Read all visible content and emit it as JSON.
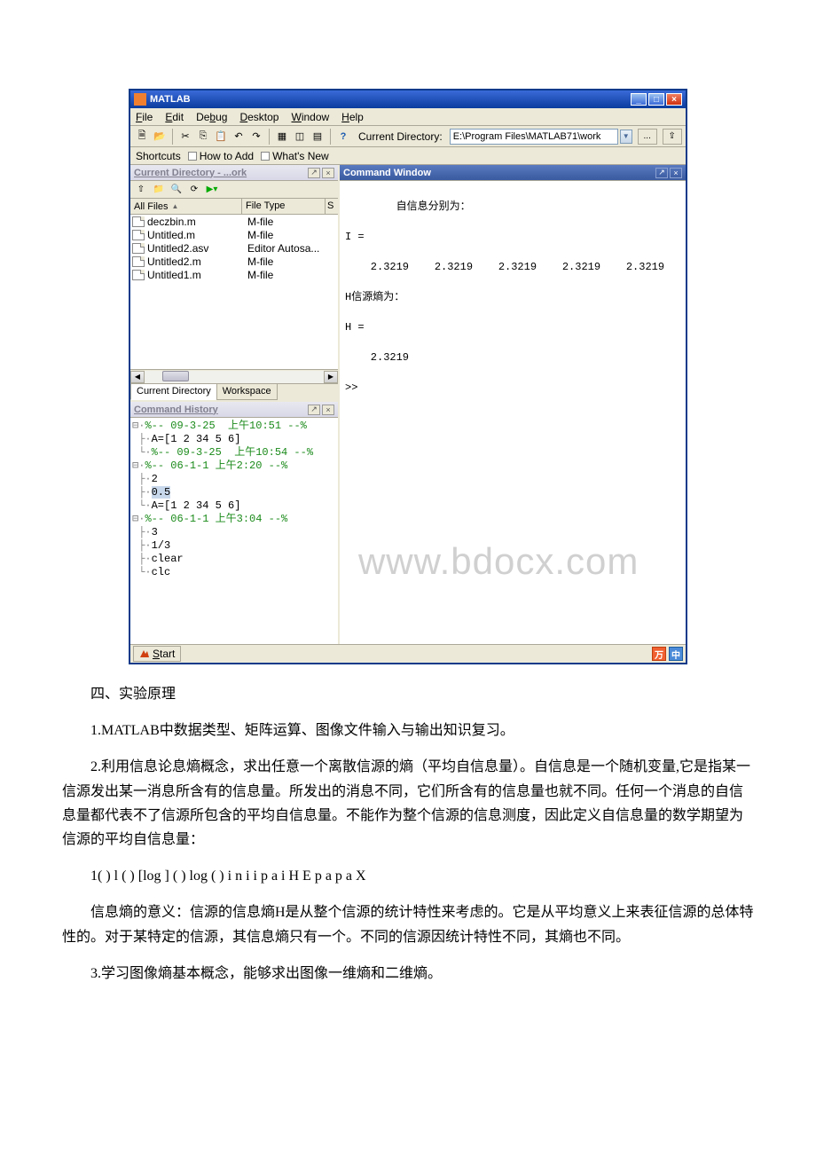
{
  "window": {
    "title": "MATLAB",
    "menus": [
      "File",
      "Edit",
      "Debug",
      "Desktop",
      "Window",
      "Help"
    ],
    "menu_accel": [
      "F",
      "E",
      "b",
      "D",
      "W",
      "H"
    ],
    "curdir_label": "Current Directory:",
    "curdir_value": "E:\\Program Files\\MATLAB71\\work",
    "shortcuts_label": "Shortcuts",
    "shortcuts": [
      "How to Add",
      "What's New"
    ]
  },
  "curdir_panel": {
    "title": "Current Directory - ...ork",
    "columns": [
      "All Files",
      "File Type",
      "S"
    ],
    "files": [
      {
        "name": "deczbin.m",
        "type": "M-file"
      },
      {
        "name": "Untitled.m",
        "type": "M-file"
      },
      {
        "name": "Untitled2.asv",
        "type": "Editor Autosa..."
      },
      {
        "name": "Untitled2.m",
        "type": "M-file"
      },
      {
        "name": "Untitled1.m",
        "type": "M-file"
      }
    ],
    "tabs": [
      "Current Directory",
      "Workspace"
    ]
  },
  "history_panel": {
    "title": "Command History",
    "lines": [
      {
        "prefix": "⊟·",
        "text": "%-- 09-3-25  上午10:51 --%",
        "sess": true
      },
      {
        "prefix": " ├·",
        "text": "A=[1 2 34 5 6]"
      },
      {
        "prefix": " └·",
        "text": "%-- 09-3-25  上午10:54 --%",
        "sess": true
      },
      {
        "prefix": "⊟·",
        "text": "%-- 06-1-1 上午2:20 --%",
        "sess": true
      },
      {
        "prefix": " ├·",
        "text": "2"
      },
      {
        "prefix": " ├·",
        "text": "0.5",
        "sel": true
      },
      {
        "prefix": " └·",
        "text": "A=[1 2 34 5 6]"
      },
      {
        "prefix": "⊟·",
        "text": "%-- 06-1-1 上午3:04 --%",
        "sess": true
      },
      {
        "prefix": " ├·",
        "text": "3"
      },
      {
        "prefix": " ├·",
        "text": "1/3"
      },
      {
        "prefix": " ├·",
        "text": "clear"
      },
      {
        "prefix": " └·",
        "text": "clc"
      }
    ]
  },
  "cmdwin": {
    "title": "Command Window",
    "output": "自信息分别为：\n\nI =\n\n    2.3219    2.3219    2.3219    2.3219    2.3219\n\nH信源熵为：\n\nH =\n\n    2.3219\n\n>> "
  },
  "watermark": "www.bdocx.com",
  "status": {
    "start": "Start",
    "ime1": "万",
    "ime2": "中"
  },
  "doc": {
    "p1": "四、实验原理",
    "p2": "1.MATLAB中数据类型、矩阵运算、图像文件输入与输出知识复习。",
    "p3": "2.利用信息论息熵概念，求出任意一个离散信源的熵（平均自信息量）。自信息是一个随机变量,它是指某一信源发出某一消息所含有的信息量。所发出的消息不同，它们所含有的信息量也就不同。任何一个消息的自信息量都代表不了信源所包含的平均自信息量。不能作为整个信源的信息测度，因此定义自信息量的数学期望为信源的平均自信息量：",
    "p4": "1( ) l ( ) [log ] ( ) log ( ) i n i i p a i H E p a p a        X",
    "p5": "信息熵的意义：信源的信息熵H是从整个信源的统计特性来考虑的。它是从平均意义上来表征信源的总体特性的。对于某特定的信源，其信息熵只有一个。不同的信源因统计特性不同，其熵也不同。",
    "p6": "3.学习图像熵基本概念，能够求出图像一维熵和二维熵。"
  }
}
